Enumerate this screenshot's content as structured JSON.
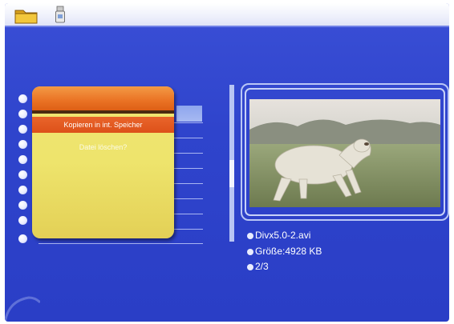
{
  "popup": {
    "options": [
      {
        "label": "Kopieren in int. Speicher",
        "selected": true
      },
      {
        "label": "Datei löschen?",
        "selected": false
      }
    ]
  },
  "file_info": {
    "filename": "Divx5.0-2.avi",
    "size": "Größe:4928 KB",
    "position": "2/3"
  },
  "icons": [
    "folder-icon",
    "usb-stick-icon"
  ],
  "colors": {
    "background": "#2f44cc",
    "popup_header": "#ea7224",
    "popup_body": "#eee46c",
    "highlight": "#8ea5ee"
  }
}
